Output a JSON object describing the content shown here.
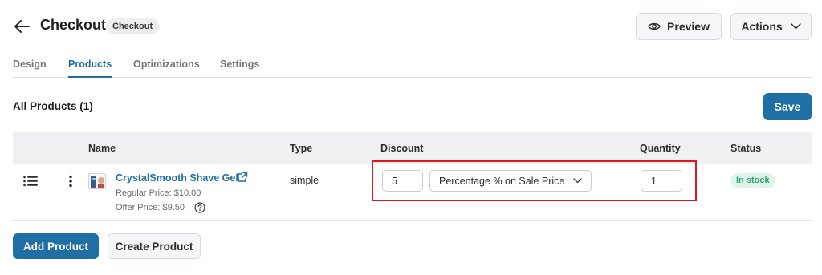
{
  "header": {
    "title": "Checkout",
    "badge": "Checkout",
    "preview_label": "Preview",
    "actions_label": "Actions"
  },
  "tabs": [
    {
      "label": "Design",
      "active": false
    },
    {
      "label": "Products",
      "active": true
    },
    {
      "label": "Optimizations",
      "active": false
    },
    {
      "label": "Settings",
      "active": false
    }
  ],
  "section": {
    "title": "All Products (1)",
    "save_label": "Save"
  },
  "table": {
    "columns": [
      "Name",
      "Type",
      "Discount",
      "Quantity",
      "Status"
    ],
    "rows": [
      {
        "name": "CrystalSmooth Shave Gel",
        "regular_price": "Regular Price: $10.00",
        "offer_price": "Offer Price: $9.50",
        "type": "simple",
        "discount_value": "5",
        "discount_mode": "Percentage % on Sale Price",
        "quantity": "1",
        "status": "In stock"
      }
    ]
  },
  "footer": {
    "add_label": "Add Product",
    "create_label": "Create Product"
  },
  "colors": {
    "accent": "#1f6fa4",
    "highlight": "#e5141b",
    "status_bg": "#dff5ea",
    "status_text": "#2fa46b"
  },
  "icons": [
    "arrow-left-icon",
    "eye-icon",
    "chevron-down-icon",
    "drag-handle-icon",
    "kebab-icon",
    "external-link-icon",
    "question-circle-icon"
  ]
}
